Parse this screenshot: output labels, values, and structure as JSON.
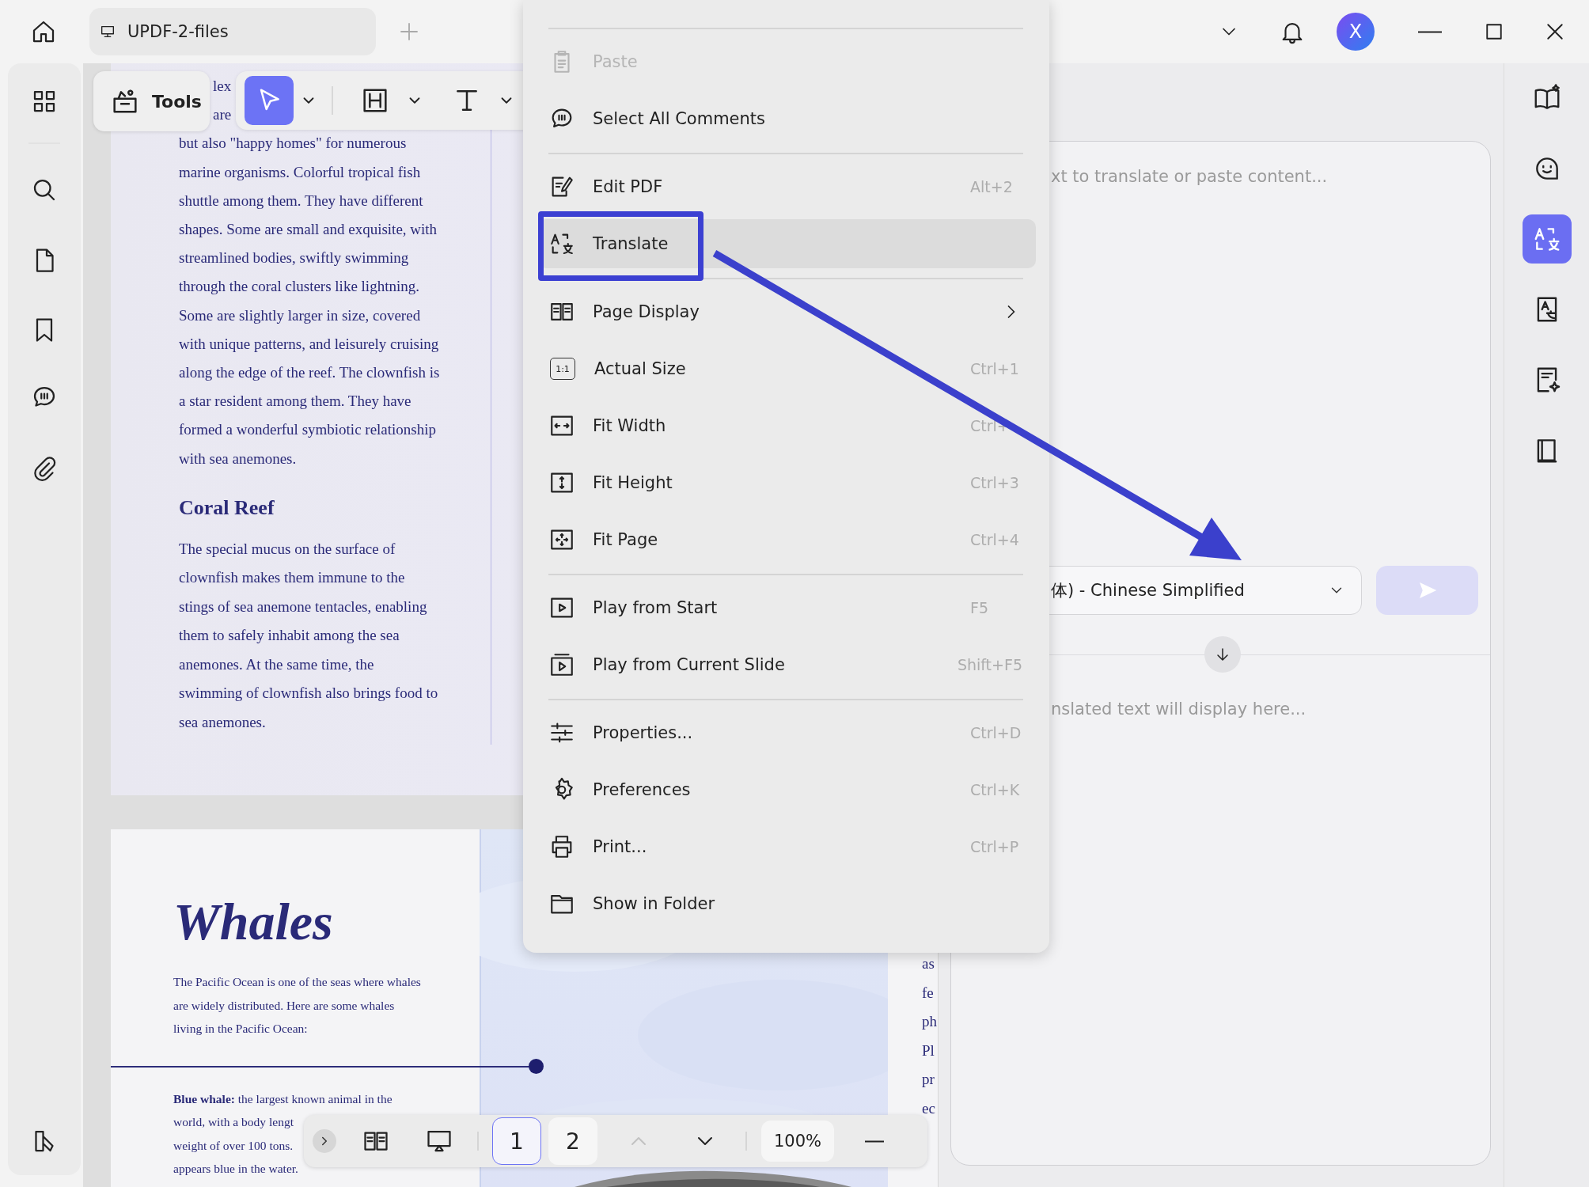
{
  "window": {
    "tab_title": "UPDF-2-files",
    "avatar_initial": "X"
  },
  "toolbar": {
    "label": "Tools",
    "tools": [
      {
        "selected": true
      },
      {
        "selected": false
      },
      {
        "selected": false
      }
    ]
  },
  "document": {
    "page_1": {
      "partial_lines": [
        "lex",
        "are"
      ],
      "paragraph_1": [
        "but also \"happy homes\" for numerous",
        "marine organisms. Colorful tropical fish",
        "shuttle among them. They have different",
        "shapes. Some are small and exquisite, with",
        "streamlined bodies, swiftly swimming",
        "through the coral clusters like lightning.",
        "Some are slightly larger in size, covered",
        "with unique patterns, and leisurely cruising",
        "along the edge of the reef. The clownfish is",
        "a star resident among them. They have",
        "formed a wonderful symbiotic relationship",
        "with sea anemones."
      ],
      "heading": "Coral Reef",
      "paragraph_2": [
        " The special mucus on the surface of",
        "clownfish makes them immune to the",
        "stings of sea anemone tentacles, enabling",
        "them to safely inhabit among the sea",
        "anemones. At the same time, the",
        "swimming of clownfish also brings food to",
        "sea anemones."
      ]
    },
    "page_2": {
      "title": "Whales",
      "intro": [
        "The Pacific Ocean is one of the seas where whales",
        "are widely distributed. Here are some whales",
        "living in the Pacific Ocean:"
      ],
      "entry": [
        "**Blue whale:** the largest known animal in the",
        "world, with a body lengt",
        "weight of over 100 tons.",
        "appears blue in the water."
      ],
      "side_fragments": [
        "as",
        "fe",
        "ph",
        "Pl",
        "pr",
        "ec"
      ]
    }
  },
  "context_menu": {
    "items": [
      {
        "kind": "item",
        "label": "Paste",
        "disabled": true,
        "selected": false,
        "callout": false
      },
      {
        "kind": "item",
        "label": "Select All Comments",
        "disabled": false,
        "selected": false,
        "callout": false
      },
      {
        "kind": "separator"
      },
      {
        "kind": "item",
        "label": "Edit PDF",
        "shortcut": "Alt+2",
        "disabled": false,
        "selected": false,
        "callout": false
      },
      {
        "kind": "item",
        "label": "Translate",
        "disabled": false,
        "selected": true,
        "callout": true
      },
      {
        "kind": "separator"
      },
      {
        "kind": "submenu",
        "label": "Page Display",
        "disabled": false,
        "selected": false,
        "callout": false
      },
      {
        "kind": "item",
        "label": "Actual Size",
        "icon_text": "1:1",
        "shortcut": "Ctrl+1",
        "disabled": false,
        "selected": false,
        "callout": false
      },
      {
        "kind": "item",
        "label": "Fit Width",
        "shortcut": "Ctrl+",
        "disabled": false,
        "selected": false,
        "callout": false
      },
      {
        "kind": "item",
        "label": "Fit Height",
        "shortcut": "Ctrl+3",
        "disabled": false,
        "selected": false,
        "callout": false
      },
      {
        "kind": "item",
        "label": "Fit Page",
        "shortcut": "Ctrl+4",
        "disabled": false,
        "selected": false,
        "callout": false
      },
      {
        "kind": "separator"
      },
      {
        "kind": "item",
        "label": "Play from Start",
        "shortcut": "F5",
        "disabled": false,
        "selected": false,
        "callout": false
      },
      {
        "kind": "item",
        "label": "Play from Current Slide",
        "shortcut": "Shift+F5",
        "disabled": false,
        "selected": false,
        "callout": false
      },
      {
        "kind": "separator"
      },
      {
        "kind": "item",
        "label": "Properties...",
        "shortcut": "Ctrl+D",
        "disabled": false,
        "selected": false,
        "callout": false
      },
      {
        "kind": "item",
        "label": "Preferences",
        "shortcut": "Ctrl+K",
        "disabled": false,
        "selected": false,
        "callout": false
      },
      {
        "kind": "item",
        "label": "Print...",
        "shortcut": "Ctrl+P",
        "disabled": false,
        "selected": false,
        "callout": false
      },
      {
        "kind": "item",
        "label": "Show in Folder",
        "disabled": false,
        "selected": false,
        "callout": false
      }
    ]
  },
  "translate_panel": {
    "input_placeholder": "xt to translate or paste content...",
    "language": "体) - Chinese Simplified",
    "send_disabled": true,
    "output_placeholder": "nslated text will display here..."
  },
  "right_rail": [
    {
      "selected": false
    },
    {
      "selected": false
    },
    {
      "selected": true
    },
    {
      "selected": false
    },
    {
      "selected": false
    },
    {
      "selected": false
    }
  ],
  "page_bar": {
    "pages": [
      {
        "label": "1",
        "selected": true
      },
      {
        "label": "2",
        "selected": false
      }
    ],
    "previous_disabled": true,
    "zoom": "100%"
  }
}
